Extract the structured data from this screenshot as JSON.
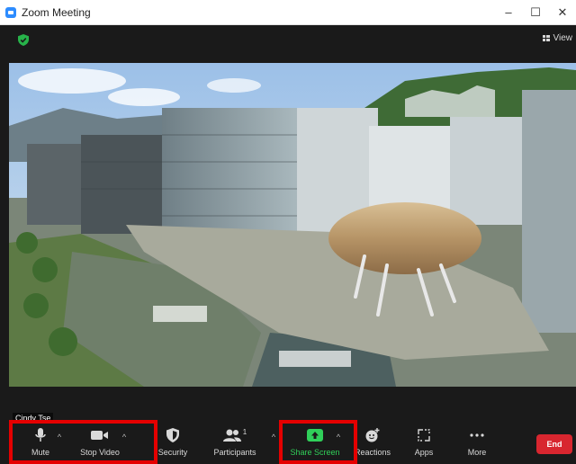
{
  "window": {
    "title": "Zoom Meeting",
    "controls": {
      "minimize": "–",
      "maximize": "☐",
      "close": "✕"
    }
  },
  "header": {
    "view_label": "View"
  },
  "participant": {
    "name": "Cindy Tse"
  },
  "toolbar": {
    "mute_label": "Mute",
    "stop_video_label": "Stop Video",
    "security_label": "Security",
    "participants_label": "Participants",
    "participants_count": "1",
    "share_screen_label": "Share Screen",
    "reactions_label": "Reactions",
    "apps_label": "Apps",
    "more_label": "More",
    "end_label": "End"
  },
  "colors": {
    "background": "#1a1a1a",
    "share_green": "#30d05a",
    "end_red": "#d8262f",
    "highlight_red": "#e50000",
    "zoom_blue": "#2D8CFF"
  },
  "icons": {
    "app": "zoom-app-icon",
    "shield": "shield-check-icon",
    "view": "grid-view-icon",
    "mute": "microphone-icon",
    "video": "video-camera-icon",
    "security": "security-shield-icon",
    "participants": "participants-icon",
    "share": "share-screen-arrow-icon",
    "reactions": "emoji-plus-icon",
    "apps": "apps-icon",
    "more": "more-dots-icon"
  }
}
